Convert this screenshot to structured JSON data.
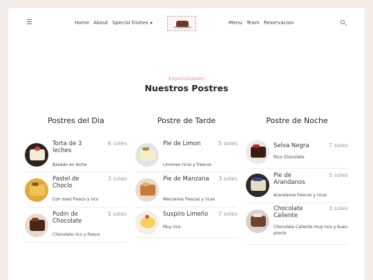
{
  "nav": {
    "left_links": [
      "Home",
      "About",
      "Special Dishes"
    ],
    "right_links": [
      "Menu",
      "Team",
      "Reservacion"
    ],
    "icons": [
      "hamburger-icon",
      "search-icon",
      "chevron-down-icon"
    ]
  },
  "section": {
    "subtitle": "Especialidades",
    "title": "Nuestros Postres"
  },
  "columns": [
    {
      "heading": "Postres del Dia",
      "items": [
        {
          "name": "Torta de 3 leches",
          "price": "6 soles",
          "desc": "Basado en leche"
        },
        {
          "name": "Pastel de Choclo",
          "price": "3 soles",
          "desc": "Con maiz fresco y rico"
        },
        {
          "name": "Pudin de Chocolate",
          "price": "5 soles",
          "desc": "Chocolate rico y fresco"
        }
      ]
    },
    {
      "heading": "Postre de Tarde",
      "items": [
        {
          "name": "Pie de Limon",
          "price": "5 soles",
          "desc": "Limones ricos y frescos"
        },
        {
          "name": "Pie de Manzana",
          "price": "3 soles",
          "desc": "Manzanas frescas y ricas"
        },
        {
          "name": "Suspiro Limeño",
          "price": "7 soles",
          "desc": "Muy rico"
        }
      ]
    },
    {
      "heading": "Postre de Noche",
      "items": [
        {
          "name": "Selva Negra",
          "price": "7 soles",
          "desc": "Rico Chocolate"
        },
        {
          "name": "Pie de Arandanos",
          "price": "5 soles",
          "desc": "Arandanos frescos y ricos"
        },
        {
          "name": "Chocolate Caliente",
          "price": "3 soles",
          "desc": "Chocolate Caliente muy rico y buen precio"
        }
      ]
    }
  ]
}
